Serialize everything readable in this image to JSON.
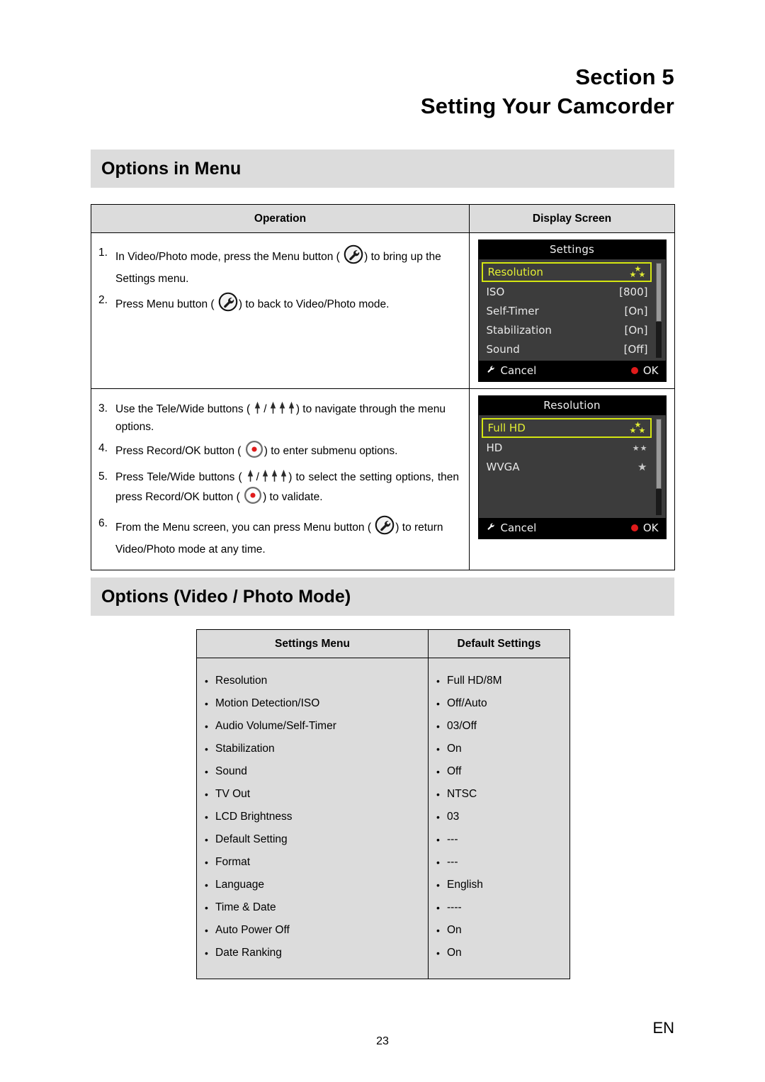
{
  "header": {
    "section_label": "Section 5",
    "title": "Setting Your Camcorder"
  },
  "sections": {
    "options_in_menu": {
      "title": "Options in Menu",
      "table": {
        "headers": [
          "Operation",
          "Display Screen"
        ],
        "rows": [
          {
            "steps": [
              {
                "num": "1.",
                "before": "In Video/Photo mode, press the Menu button (",
                "icon": "wrench-icon",
                "after": ") to bring up the Settings menu."
              },
              {
                "num": "2.",
                "before": "Press Menu button (",
                "icon": "wrench-icon",
                "after": ") to back to Video/Photo mode."
              }
            ]
          },
          {
            "steps": [
              {
                "num": "3.",
                "before": "Use the Tele/Wide buttons (",
                "icon": "tele-wide-icon",
                "after": ") to navigate through the menu options."
              },
              {
                "num": "4.",
                "before": "Press Record/OK button (",
                "icon": "record-ok-icon",
                "after": ") to enter submenu options."
              },
              {
                "num": "5.",
                "before": "Press Tele/Wide buttons (",
                "icon": "tele-wide-icon",
                "middle": ") to select the setting options, then press Record/OK button (",
                "icon2": "record-ok-icon",
                "after": ") to validate."
              },
              {
                "num": "6.",
                "before": "From the Menu screen, you can press Menu button (",
                "icon": "wrench-icon",
                "after": ") to return Video/Photo mode at any time."
              }
            ]
          }
        ]
      }
    },
    "options_video_photo": {
      "title": "Options (Video / Photo Mode)",
      "table": {
        "headers": [
          "Settings Menu",
          "Default Settings"
        ],
        "settings_menu": [
          "Resolution",
          "Motion Detection/ISO",
          "Audio Volume/Self-Timer",
          "Stabilization",
          "Sound",
          "TV Out",
          "LCD Brightness",
          "Default Setting",
          "Format",
          "Language",
          "Time & Date",
          "Auto Power Off",
          "Date Ranking"
        ],
        "default_settings": [
          "Full HD/8M",
          "Off/Auto",
          "03/Off",
          "On",
          "Off",
          "NTSC",
          "03",
          "---",
          "---",
          "English",
          "----",
          "On",
          "On"
        ]
      }
    }
  },
  "camera_screens": {
    "settings_screen": {
      "title": "Settings",
      "rows": [
        {
          "label": "Resolution",
          "value": "",
          "stars": "three",
          "selected": true
        },
        {
          "label": "ISO",
          "value": "[800]",
          "selected": false
        },
        {
          "label": "Self-Timer",
          "value": "[On]",
          "selected": false
        },
        {
          "label": "Stabilization",
          "value": "[On]",
          "selected": false
        },
        {
          "label": "Sound",
          "value": "[Off]",
          "selected": false
        }
      ],
      "footer": {
        "cancel": "Cancel",
        "ok": "OK"
      }
    },
    "resolution_screen": {
      "title": "Resolution",
      "rows": [
        {
          "label": "Full HD",
          "value": "",
          "stars": "three",
          "selected": true
        },
        {
          "label": "HD",
          "value": "",
          "stars": "two",
          "selected": false
        },
        {
          "label": "WVGA",
          "value": "",
          "stars": "one",
          "selected": false
        }
      ],
      "footer": {
        "cancel": "Cancel",
        "ok": "OK"
      }
    }
  },
  "footer": {
    "language_code": "EN",
    "page_number": "23"
  },
  "colors": {
    "highlight_yellow": "#e2ee34",
    "record_red": "#e01b1b",
    "band_gray": "#dcdcdc",
    "screen_gray": "#3c3c3c"
  }
}
